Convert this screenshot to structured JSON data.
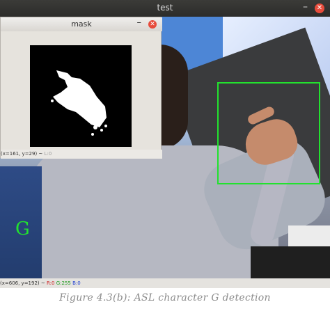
{
  "test_window": {
    "title": "test",
    "minimize_symbol": "–",
    "close_symbol": "✕",
    "prediction": "G",
    "bbox_color": "#22e22e",
    "status": {
      "coords": "(x=606, y=192) ~",
      "r": "R:0",
      "g": "G:255",
      "b": "B:0"
    }
  },
  "mask_window": {
    "title": "mask",
    "minimize_symbol": "–",
    "close_symbol": "✕",
    "status_coords": "(x=161, y=29) ~",
    "status_value": "L:0"
  },
  "caption": "Figure 4.3(b): ASL character G detection"
}
